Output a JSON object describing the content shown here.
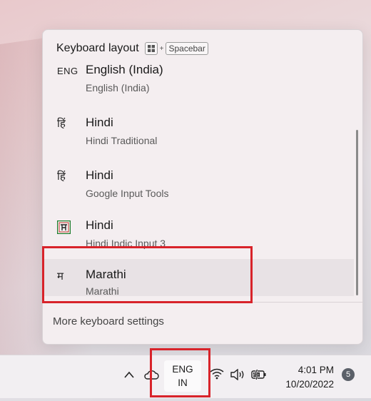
{
  "flyout": {
    "title": "Keyboard layout",
    "shortcut_plus": "+",
    "shortcut_key": "Spacebar",
    "items": [
      {
        "icon_text": "ENG",
        "title": "English (India)",
        "subtitle": "English (India)"
      },
      {
        "icon_text": "हिं",
        "title": "Hindi",
        "subtitle": "Hindi Traditional"
      },
      {
        "icon_text": "हिं",
        "title": "Hindi",
        "subtitle": "Google Input Tools"
      },
      {
        "icon_text": "",
        "icon": "hindi-indic-ime-icon",
        "title": "Hindi",
        "subtitle": "Hindi Indic Input 3"
      },
      {
        "icon_text": "म",
        "title": "Marathi",
        "subtitle": "Marathi",
        "selected": true
      }
    ],
    "more_settings": "More keyboard settings"
  },
  "taskbar": {
    "lang_line1": "ENG",
    "lang_line2": "IN",
    "time": "4:01 PM",
    "date": "10/20/2022",
    "notification_count": "5",
    "icons": [
      "chevron-up-icon",
      "onedrive-cloud-icon",
      "wifi-icon",
      "volume-icon",
      "battery-charging-icon"
    ]
  },
  "colors": {
    "highlight": "#d8232a",
    "badge": "#5b6069"
  }
}
